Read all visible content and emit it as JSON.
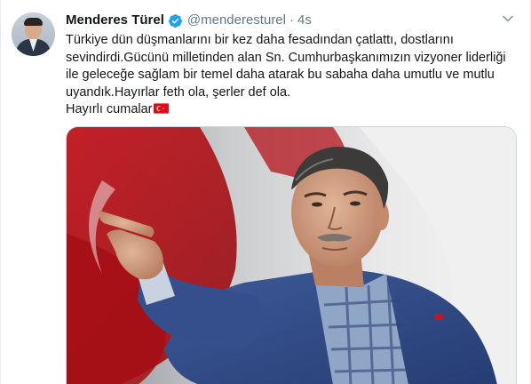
{
  "tweet": {
    "author_name": "Menderes Türel",
    "handle": "@menderesturel",
    "separator": "·",
    "time": "4s",
    "lines": [
      "Türkiye dün düşmanlarını bir kez daha fesadından çatlattı, dostlarını sevindirdi.Gücünü milletinden alan Sn. Cumhurbaşkanımızın vizyoner liderliği ile geleceğe sağlam bir temel daha atarak bu sabaha daha umutlu ve mutlu uyandık.Hayırlar feth ola, şerler def ola.",
      "Hayırlı cumalar"
    ],
    "media_alt": "photo"
  },
  "icons": {
    "verified": "verified-badge-icon",
    "chevron": "chevron-down-icon",
    "flag": "turkey-flag-emoji"
  },
  "colors": {
    "text": "#14171a",
    "secondary": "#657786",
    "verified": "#1da1f2",
    "flag_red": "#e30a17"
  }
}
